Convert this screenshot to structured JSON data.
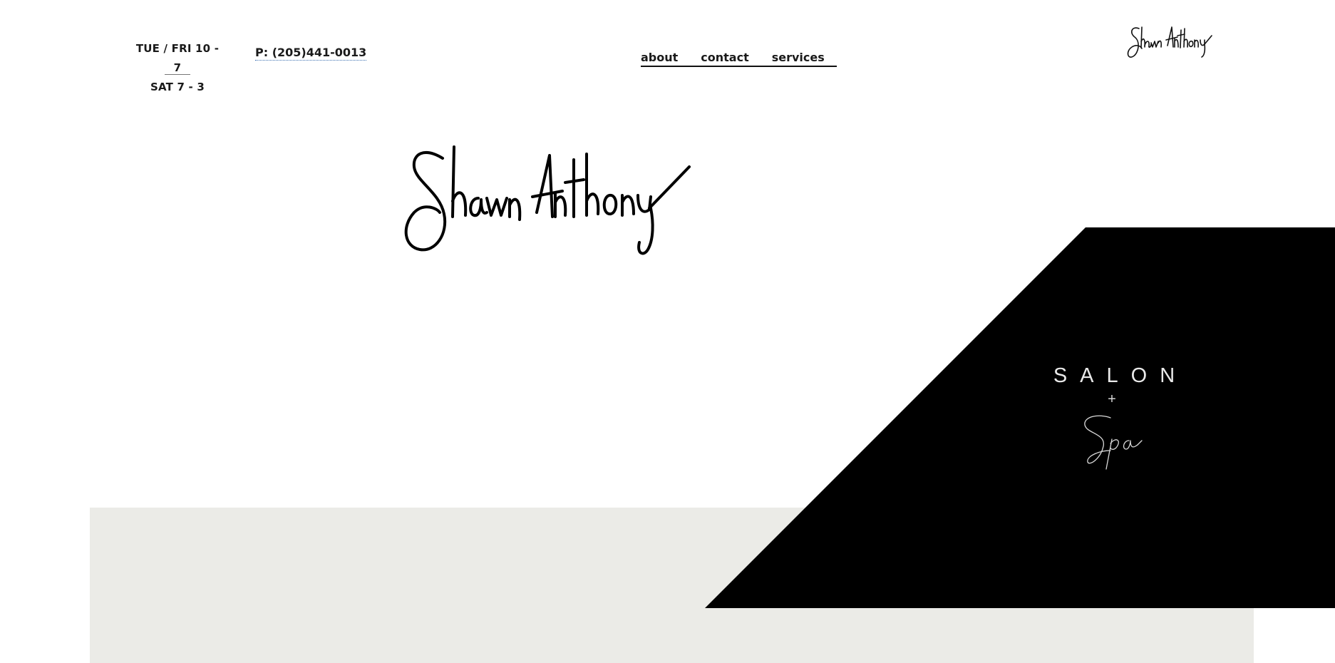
{
  "header": {
    "hours": {
      "line1": "TUE / FRI 10 - 7",
      "line2": "SAT 7 - 3"
    },
    "phone": "P: (205)441-0013",
    "nav": [
      {
        "label": "about"
      },
      {
        "label": "contact"
      },
      {
        "label": "services"
      }
    ],
    "corner_logo_text": "Shawn Anthony"
  },
  "hero": {
    "signature_text": "Shawn Anthony",
    "salon_label": "SALON",
    "plus_label": "+",
    "spa_text": "Spa"
  },
  "colors": {
    "background": "#ffffff",
    "black_panel": "#000000",
    "gray_band": "#ebebe7",
    "text": "#1a1a1a",
    "salon_text": "#e9e9e9"
  }
}
